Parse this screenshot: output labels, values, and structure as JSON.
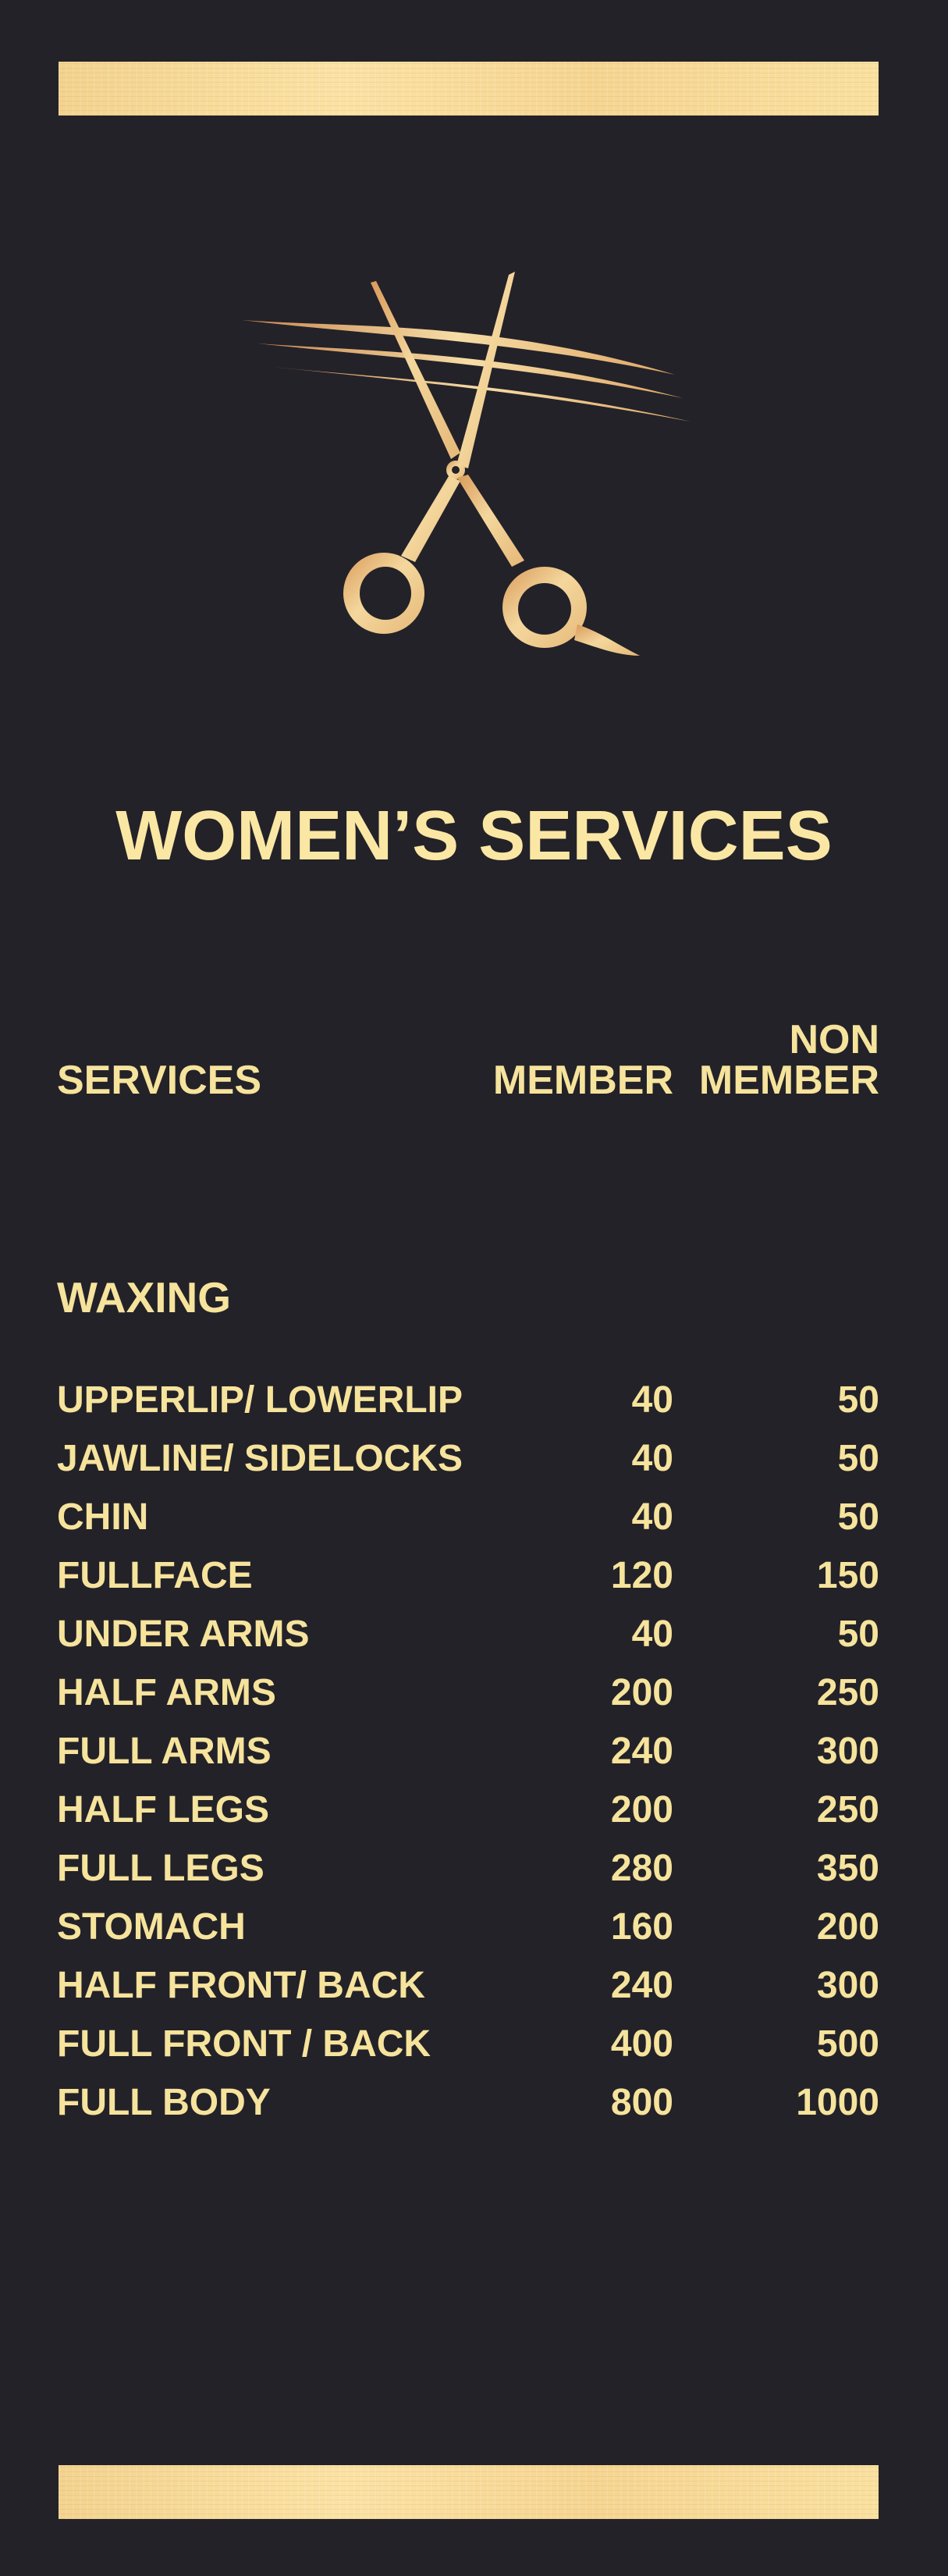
{
  "colors": {
    "background": "#232229",
    "text_gold": "#f6e39c",
    "bar_gold": "#f6d592"
  },
  "logo": {
    "icon": "scissors-cutting-hair-icon"
  },
  "title": "WOMEN’S SERVICES",
  "headers": {
    "services": "SERVICES",
    "member": "MEMBER",
    "non_member_line1": "NON",
    "non_member_line2": "MEMBER"
  },
  "section": "WAXING",
  "items": [
    {
      "service": "UPPERLIP/ LOWERLIP",
      "member": "40",
      "non_member": "50"
    },
    {
      "service": "JAWLINE/ SIDELOCKS",
      "member": "40",
      "non_member": "50"
    },
    {
      "service": "CHIN",
      "member": "40",
      "non_member": "50"
    },
    {
      "service": "FULLFACE",
      "member": "120",
      "non_member": "150"
    },
    {
      "service": "UNDER ARMS",
      "member": "40",
      "non_member": "50"
    },
    {
      "service": "HALF ARMS",
      "member": "200",
      "non_member": "250"
    },
    {
      "service": "FULL ARMS",
      "member": "240",
      "non_member": "300"
    },
    {
      "service": "HALF LEGS",
      "member": "200",
      "non_member": "250"
    },
    {
      "service": "FULL LEGS",
      "member": "280",
      "non_member": "350"
    },
    {
      "service": "STOMACH",
      "member": "160",
      "non_member": "200"
    },
    {
      "service": "HALF FRONT/ BACK",
      "member": "240",
      "non_member": "300"
    },
    {
      "service": "FULL FRONT / BACK",
      "member": "400",
      "non_member": "500"
    },
    {
      "service": "FULL BODY",
      "member": "800",
      "non_member": "1000"
    }
  ]
}
